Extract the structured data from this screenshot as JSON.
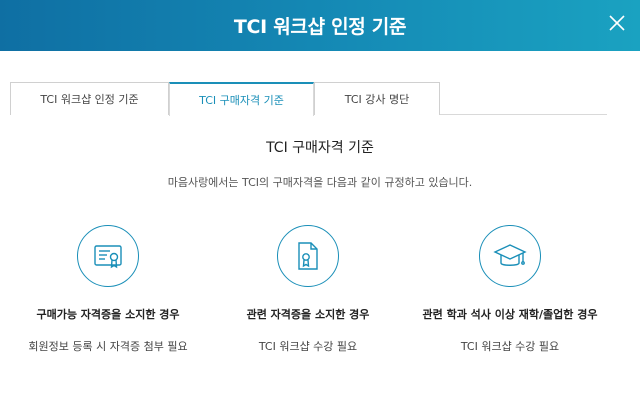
{
  "header": {
    "title": "TCI 워크샵 인정 기준",
    "close_icon": "close-icon"
  },
  "tabs": [
    {
      "label": "TCI 워크샵 인정 기준",
      "active": false
    },
    {
      "label": "TCI 구매자격 기준",
      "active": true
    },
    {
      "label": "TCI 강사 명단",
      "active": false
    }
  ],
  "main": {
    "title": "TCI 구매자격 기준",
    "description": "마음사랑에서는 TCI의 구매자격을 다음과 같이 규정하고 있습니다."
  },
  "cards": [
    {
      "icon": "certificate-icon",
      "title": "구매가능 자격증을 소지한 경우",
      "subtitle": "회원정보 등록 시 자격증 첨부 필요"
    },
    {
      "icon": "document-award-icon",
      "title": "관련 자격증을 소지한 경우",
      "subtitle": "TCI 워크샵 수강 필요"
    },
    {
      "icon": "graduation-cap-icon",
      "title": "관련 학과 석사 이상 재학/졸업한 경우",
      "subtitle": "TCI 워크샵 수강 필요"
    }
  ],
  "colors": {
    "accent": "#1a8fb8",
    "header_start": "#0f6fa3",
    "header_end": "#1aa2c1"
  }
}
